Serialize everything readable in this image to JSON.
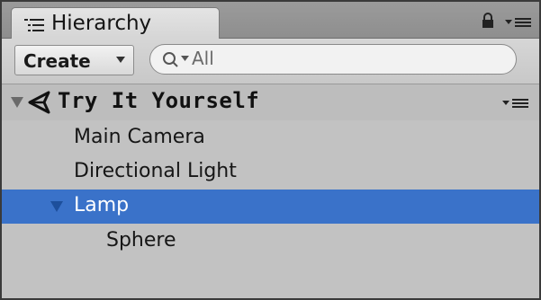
{
  "panel": {
    "tab_title": "Hierarchy"
  },
  "toolbar": {
    "create_label": "Create",
    "search_value": "All"
  },
  "hierarchy": {
    "scene_name": "Try It Yourself",
    "items": [
      {
        "label": "Main Camera",
        "selected": false
      },
      {
        "label": "Directional Light",
        "selected": false
      },
      {
        "label": "Lamp",
        "selected": true,
        "expanded": true
      },
      {
        "label": "Sphere",
        "selected": false
      }
    ]
  },
  "colors": {
    "selection": "#3a72c9",
    "panel_bg": "#c2c2c2"
  }
}
